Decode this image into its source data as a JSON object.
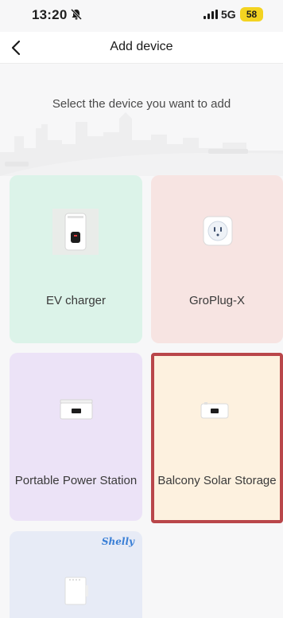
{
  "status": {
    "time": "13:20",
    "network": "5G",
    "battery": "58"
  },
  "nav": {
    "title": "Add device"
  },
  "hero": {
    "prompt": "Select the device you want to add"
  },
  "devices": [
    {
      "label": "EV charger",
      "icon": "ev-charger-icon"
    },
    {
      "label": "GroPlug-X",
      "icon": "smart-plug-icon"
    },
    {
      "label": "Portable Power Station",
      "icon": "power-station-icon"
    },
    {
      "label": "Balcony Solar Storage",
      "icon": "solar-storage-icon",
      "selected": true
    },
    {
      "label": "",
      "brand": "Shelly",
      "icon": "relay-module-icon"
    }
  ],
  "colors": {
    "selected_border": "#b9464a",
    "battery": "#f3d321"
  }
}
